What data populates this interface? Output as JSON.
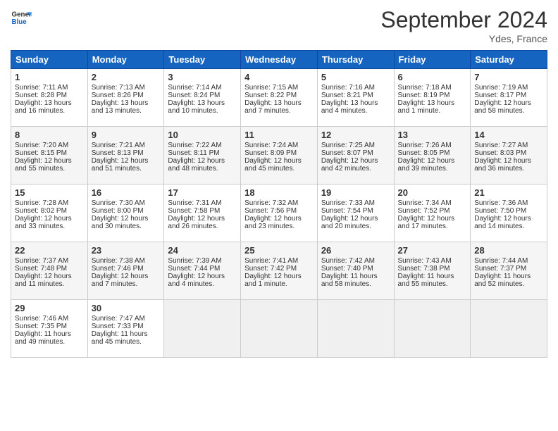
{
  "header": {
    "logo_line1": "General",
    "logo_line2": "Blue",
    "title": "September 2024",
    "location": "Ydes, France"
  },
  "days_of_week": [
    "Sunday",
    "Monday",
    "Tuesday",
    "Wednesday",
    "Thursday",
    "Friday",
    "Saturday"
  ],
  "weeks": [
    [
      {
        "day": "1",
        "lines": [
          "Sunrise: 7:11 AM",
          "Sunset: 8:28 PM",
          "Daylight: 13 hours",
          "and 16 minutes."
        ]
      },
      {
        "day": "2",
        "lines": [
          "Sunrise: 7:13 AM",
          "Sunset: 8:26 PM",
          "Daylight: 13 hours",
          "and 13 minutes."
        ]
      },
      {
        "day": "3",
        "lines": [
          "Sunrise: 7:14 AM",
          "Sunset: 8:24 PM",
          "Daylight: 13 hours",
          "and 10 minutes."
        ]
      },
      {
        "day": "4",
        "lines": [
          "Sunrise: 7:15 AM",
          "Sunset: 8:22 PM",
          "Daylight: 13 hours",
          "and 7 minutes."
        ]
      },
      {
        "day": "5",
        "lines": [
          "Sunrise: 7:16 AM",
          "Sunset: 8:21 PM",
          "Daylight: 13 hours",
          "and 4 minutes."
        ]
      },
      {
        "day": "6",
        "lines": [
          "Sunrise: 7:18 AM",
          "Sunset: 8:19 PM",
          "Daylight: 13 hours",
          "and 1 minute."
        ]
      },
      {
        "day": "7",
        "lines": [
          "Sunrise: 7:19 AM",
          "Sunset: 8:17 PM",
          "Daylight: 12 hours",
          "and 58 minutes."
        ]
      }
    ],
    [
      {
        "day": "8",
        "lines": [
          "Sunrise: 7:20 AM",
          "Sunset: 8:15 PM",
          "Daylight: 12 hours",
          "and 55 minutes."
        ]
      },
      {
        "day": "9",
        "lines": [
          "Sunrise: 7:21 AM",
          "Sunset: 8:13 PM",
          "Daylight: 12 hours",
          "and 51 minutes."
        ]
      },
      {
        "day": "10",
        "lines": [
          "Sunrise: 7:22 AM",
          "Sunset: 8:11 PM",
          "Daylight: 12 hours",
          "and 48 minutes."
        ]
      },
      {
        "day": "11",
        "lines": [
          "Sunrise: 7:24 AM",
          "Sunset: 8:09 PM",
          "Daylight: 12 hours",
          "and 45 minutes."
        ]
      },
      {
        "day": "12",
        "lines": [
          "Sunrise: 7:25 AM",
          "Sunset: 8:07 PM",
          "Daylight: 12 hours",
          "and 42 minutes."
        ]
      },
      {
        "day": "13",
        "lines": [
          "Sunrise: 7:26 AM",
          "Sunset: 8:05 PM",
          "Daylight: 12 hours",
          "and 39 minutes."
        ]
      },
      {
        "day": "14",
        "lines": [
          "Sunrise: 7:27 AM",
          "Sunset: 8:03 PM",
          "Daylight: 12 hours",
          "and 36 minutes."
        ]
      }
    ],
    [
      {
        "day": "15",
        "lines": [
          "Sunrise: 7:28 AM",
          "Sunset: 8:02 PM",
          "Daylight: 12 hours",
          "and 33 minutes."
        ]
      },
      {
        "day": "16",
        "lines": [
          "Sunrise: 7:30 AM",
          "Sunset: 8:00 PM",
          "Daylight: 12 hours",
          "and 30 minutes."
        ]
      },
      {
        "day": "17",
        "lines": [
          "Sunrise: 7:31 AM",
          "Sunset: 7:58 PM",
          "Daylight: 12 hours",
          "and 26 minutes."
        ]
      },
      {
        "day": "18",
        "lines": [
          "Sunrise: 7:32 AM",
          "Sunset: 7:56 PM",
          "Daylight: 12 hours",
          "and 23 minutes."
        ]
      },
      {
        "day": "19",
        "lines": [
          "Sunrise: 7:33 AM",
          "Sunset: 7:54 PM",
          "Daylight: 12 hours",
          "and 20 minutes."
        ]
      },
      {
        "day": "20",
        "lines": [
          "Sunrise: 7:34 AM",
          "Sunset: 7:52 PM",
          "Daylight: 12 hours",
          "and 17 minutes."
        ]
      },
      {
        "day": "21",
        "lines": [
          "Sunrise: 7:36 AM",
          "Sunset: 7:50 PM",
          "Daylight: 12 hours",
          "and 14 minutes."
        ]
      }
    ],
    [
      {
        "day": "22",
        "lines": [
          "Sunrise: 7:37 AM",
          "Sunset: 7:48 PM",
          "Daylight: 12 hours",
          "and 11 minutes."
        ]
      },
      {
        "day": "23",
        "lines": [
          "Sunrise: 7:38 AM",
          "Sunset: 7:46 PM",
          "Daylight: 12 hours",
          "and 7 minutes."
        ]
      },
      {
        "day": "24",
        "lines": [
          "Sunrise: 7:39 AM",
          "Sunset: 7:44 PM",
          "Daylight: 12 hours",
          "and 4 minutes."
        ]
      },
      {
        "day": "25",
        "lines": [
          "Sunrise: 7:41 AM",
          "Sunset: 7:42 PM",
          "Daylight: 12 hours",
          "and 1 minute."
        ]
      },
      {
        "day": "26",
        "lines": [
          "Sunrise: 7:42 AM",
          "Sunset: 7:40 PM",
          "Daylight: 11 hours",
          "and 58 minutes."
        ]
      },
      {
        "day": "27",
        "lines": [
          "Sunrise: 7:43 AM",
          "Sunset: 7:38 PM",
          "Daylight: 11 hours",
          "and 55 minutes."
        ]
      },
      {
        "day": "28",
        "lines": [
          "Sunrise: 7:44 AM",
          "Sunset: 7:37 PM",
          "Daylight: 11 hours",
          "and 52 minutes."
        ]
      }
    ],
    [
      {
        "day": "29",
        "lines": [
          "Sunrise: 7:46 AM",
          "Sunset: 7:35 PM",
          "Daylight: 11 hours",
          "and 49 minutes."
        ]
      },
      {
        "day": "30",
        "lines": [
          "Sunrise: 7:47 AM",
          "Sunset: 7:33 PM",
          "Daylight: 11 hours",
          "and 45 minutes."
        ]
      },
      {
        "day": "",
        "lines": []
      },
      {
        "day": "",
        "lines": []
      },
      {
        "day": "",
        "lines": []
      },
      {
        "day": "",
        "lines": []
      },
      {
        "day": "",
        "lines": []
      }
    ]
  ]
}
